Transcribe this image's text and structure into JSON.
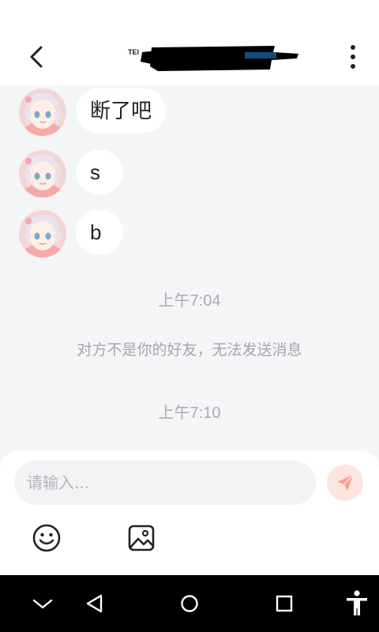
{
  "header": {
    "title_prefix": "TEI",
    "back_icon": "chevron-left-icon",
    "more_icon": "more-vertical-icon"
  },
  "messages": [
    {
      "text": "断了吧"
    },
    {
      "text": "s"
    },
    {
      "text": "b"
    }
  ],
  "timestamps": {
    "first": "上午7:04",
    "second": "上午7:10"
  },
  "system_notice": "对方不是你的好友，无法发送消息",
  "composer": {
    "placeholder": "请输入...",
    "send_icon": "send-icon",
    "emoji_icon": "emoji-icon",
    "image_icon": "image-icon"
  },
  "navbar": {
    "icons": [
      "chevron-down-icon",
      "back-triangle-icon",
      "home-circle-icon",
      "recents-square-icon",
      "accessibility-icon"
    ]
  },
  "colors": {
    "background": "#f4f5f7",
    "bubble": "#ffffff",
    "muted_text": "#a9abb0",
    "send_button": "#fde4de",
    "send_icon": "#f7a08f"
  }
}
